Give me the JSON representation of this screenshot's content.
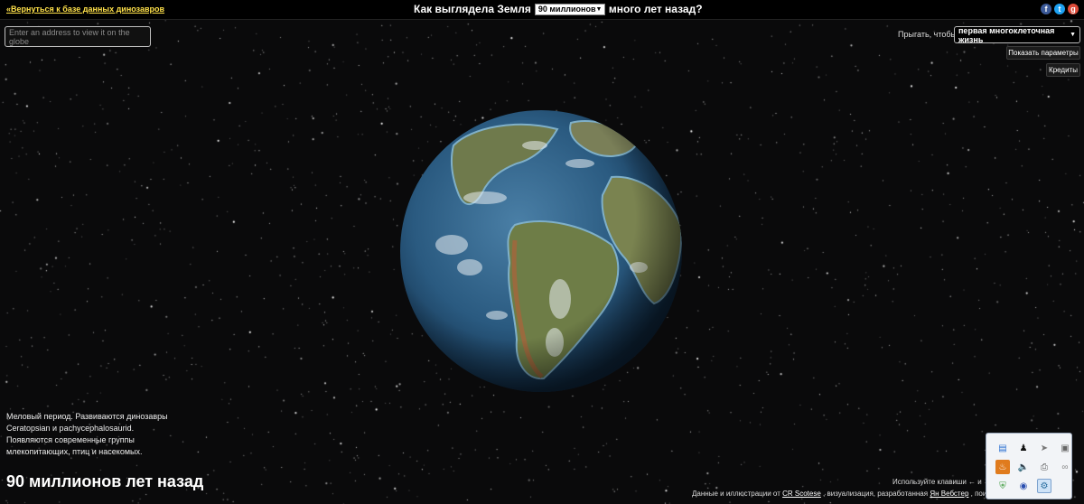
{
  "header": {
    "back_link": "«Вернуться к базе данных динозавров",
    "title_prefix": "Как выглядела Земля",
    "era_selected": "90 миллионов",
    "title_suffix": "много лет назад?"
  },
  "social": {
    "facebook": "f",
    "twitter": "t",
    "gplus": "g"
  },
  "search": {
    "placeholder": "Enter an address to view it on the globe"
  },
  "jump": {
    "label": "Прыгать, чтобы...",
    "selected": "первая многоклеточная жизнь"
  },
  "buttons": {
    "params": "Показать параметры",
    "credits": "Кредиты"
  },
  "description": {
    "line1": "Меловый период. Развиваются динозавры",
    "line2": "Ceratopsian и pachycephalosaurid.",
    "line3": "Появляются современные группы",
    "line4": "млекопитающих, птиц и насекомых."
  },
  "era_label": "90 миллионов лет назад",
  "footer": {
    "keys_hint": "Используйте клавиши ← и →",
    "credit_prefix": "Данные и иллюстрации от",
    "credit_author": "CR Scotese",
    "credit_mid": ", визуализация, разработанная",
    "credit_dev": "Ян Вебстер",
    "credit_suffix": ", поиск п"
  },
  "tray_icons": [
    "document-icon",
    "penguin-icon",
    "arrow-icon",
    "screen-icon",
    "flame-icon",
    "speaker-icon",
    "printer-icon",
    "link-icon",
    "shield-icon",
    "globe-icon",
    "tool-icon"
  ],
  "colors": {
    "link": "#ffe14a",
    "background": "#0a0a0b",
    "ocean": "#2a5a80",
    "land": "#6f7a4c"
  }
}
